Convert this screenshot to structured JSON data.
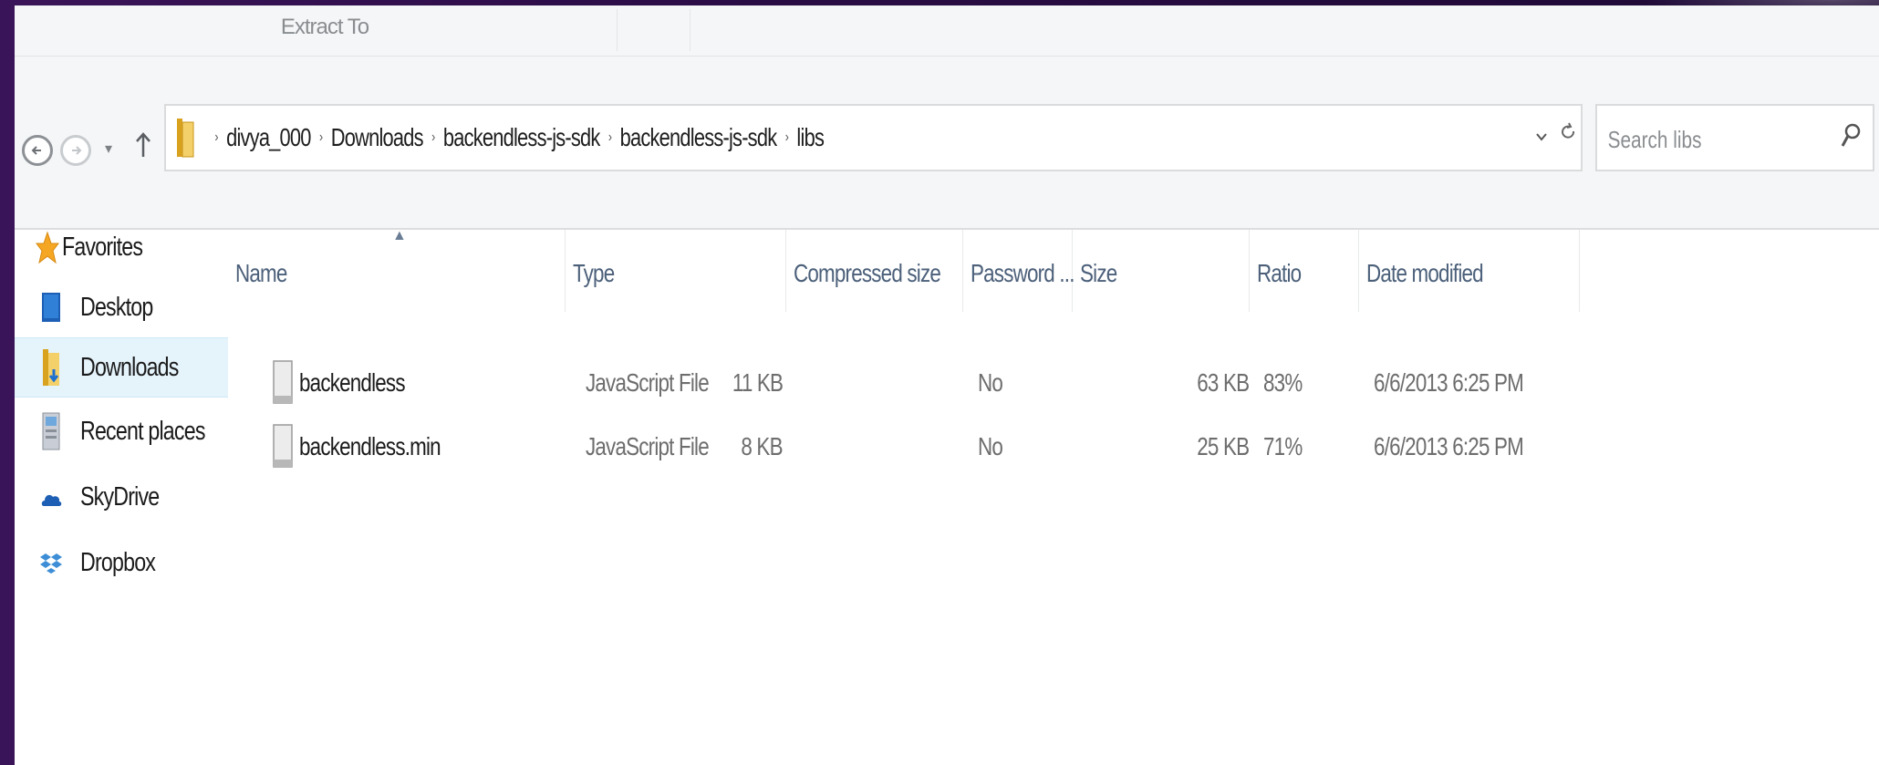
{
  "ribbon": {
    "extract_label": "Extract To"
  },
  "address": {
    "crumbs": [
      "divya_000",
      "Downloads",
      "backendless-js-sdk",
      "backendless-js-sdk",
      "libs"
    ]
  },
  "search": {
    "placeholder": "Search libs"
  },
  "navpane": {
    "items": [
      {
        "label": "Favorites",
        "icon": "star-icon"
      },
      {
        "label": "Desktop",
        "icon": "desktop-icon"
      },
      {
        "label": "Downloads",
        "icon": "downloads-folder-icon",
        "selected": true
      },
      {
        "label": "Recent places",
        "icon": "recent-places-icon"
      },
      {
        "label": "SkyDrive",
        "icon": "skydrive-icon"
      },
      {
        "label": "Dropbox",
        "icon": "dropbox-icon"
      }
    ]
  },
  "columns": {
    "name": "Name",
    "type": "Type",
    "compressed": "Compressed size",
    "password": "Password ...",
    "size": "Size",
    "ratio": "Ratio",
    "date": "Date modified"
  },
  "files": [
    {
      "name": "backendless",
      "type": "JavaScript File",
      "compressed": "11 KB",
      "password": "No",
      "size": "63 KB",
      "ratio": "83%",
      "date": "6/6/2013 6:25 PM"
    },
    {
      "name": "backendless.min",
      "type": "JavaScript File",
      "compressed": "8 KB",
      "password": "No",
      "size": "25 KB",
      "ratio": "71%",
      "date": "6/6/2013 6:25 PM"
    }
  ],
  "colors": {
    "header_text": "#4c607a",
    "selection": "#e5f3fb",
    "background": "#2a0c45"
  }
}
